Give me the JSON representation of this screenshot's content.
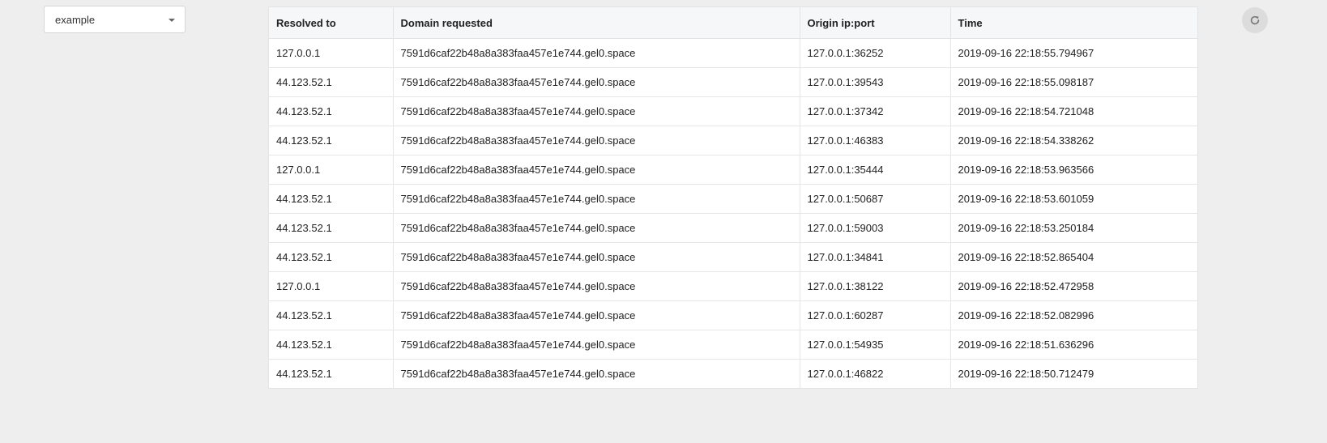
{
  "selector": {
    "value": "example"
  },
  "table": {
    "headers": [
      "Resolved to",
      "Domain requested",
      "Origin ip:port",
      "Time"
    ],
    "rows": [
      [
        "127.0.0.1",
        "7591d6caf22b48a8a383faa457e1e744.gel0.space",
        "127.0.0.1:36252",
        "2019-09-16 22:18:55.794967"
      ],
      [
        "44.123.52.1",
        "7591d6caf22b48a8a383faa457e1e744.gel0.space",
        "127.0.0.1:39543",
        "2019-09-16 22:18:55.098187"
      ],
      [
        "44.123.52.1",
        "7591d6caf22b48a8a383faa457e1e744.gel0.space",
        "127.0.0.1:37342",
        "2019-09-16 22:18:54.721048"
      ],
      [
        "44.123.52.1",
        "7591d6caf22b48a8a383faa457e1e744.gel0.space",
        "127.0.0.1:46383",
        "2019-09-16 22:18:54.338262"
      ],
      [
        "127.0.0.1",
        "7591d6caf22b48a8a383faa457e1e744.gel0.space",
        "127.0.0.1:35444",
        "2019-09-16 22:18:53.963566"
      ],
      [
        "44.123.52.1",
        "7591d6caf22b48a8a383faa457e1e744.gel0.space",
        "127.0.0.1:50687",
        "2019-09-16 22:18:53.601059"
      ],
      [
        "44.123.52.1",
        "7591d6caf22b48a8a383faa457e1e744.gel0.space",
        "127.0.0.1:59003",
        "2019-09-16 22:18:53.250184"
      ],
      [
        "44.123.52.1",
        "7591d6caf22b48a8a383faa457e1e744.gel0.space",
        "127.0.0.1:34841",
        "2019-09-16 22:18:52.865404"
      ],
      [
        "127.0.0.1",
        "7591d6caf22b48a8a383faa457e1e744.gel0.space",
        "127.0.0.1:38122",
        "2019-09-16 22:18:52.472958"
      ],
      [
        "44.123.52.1",
        "7591d6caf22b48a8a383faa457e1e744.gel0.space",
        "127.0.0.1:60287",
        "2019-09-16 22:18:52.082996"
      ],
      [
        "44.123.52.1",
        "7591d6caf22b48a8a383faa457e1e744.gel0.space",
        "127.0.0.1:54935",
        "2019-09-16 22:18:51.636296"
      ],
      [
        "44.123.52.1",
        "7591d6caf22b48a8a383faa457e1e744.gel0.space",
        "127.0.0.1:46822",
        "2019-09-16 22:18:50.712479"
      ]
    ]
  },
  "refresh": {
    "icon": "refresh-icon"
  }
}
